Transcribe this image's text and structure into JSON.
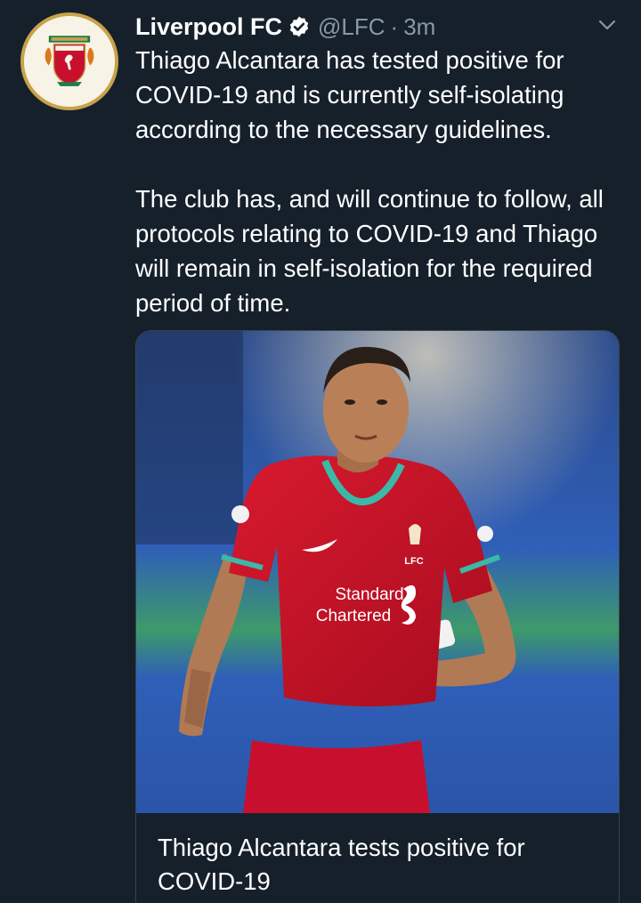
{
  "account": {
    "name": "Liverpool FC",
    "handle": "@LFC",
    "separator": "·",
    "time": "3m",
    "verified": true,
    "avatar_icon": "lfc-crest-icon"
  },
  "tweet": {
    "paragraph_1": "Thiago Alcantara has tested positive for COVID-19 and is currently self-isolating according to the necessary guidelines.",
    "paragraph_2": "The club has, and will continue to follow, all protocols relating to COVID-19 and Thiago will remain in self-isolation for the required period of time."
  },
  "card": {
    "title": "Thiago Alcantara tests positive for COVID-19",
    "image_icon": "player-photo",
    "shirt_text": {
      "sponsor_line1": "Standard",
      "sponsor_line2": "Chartered",
      "club": "LFC"
    }
  },
  "colors": {
    "background": "#15202b",
    "secondary_text": "#8899a6",
    "card_border": "#38444d",
    "kit_red": "#c8102e",
    "kit_teal": "#3cb8a8",
    "crest_gold": "#c7a24a"
  }
}
